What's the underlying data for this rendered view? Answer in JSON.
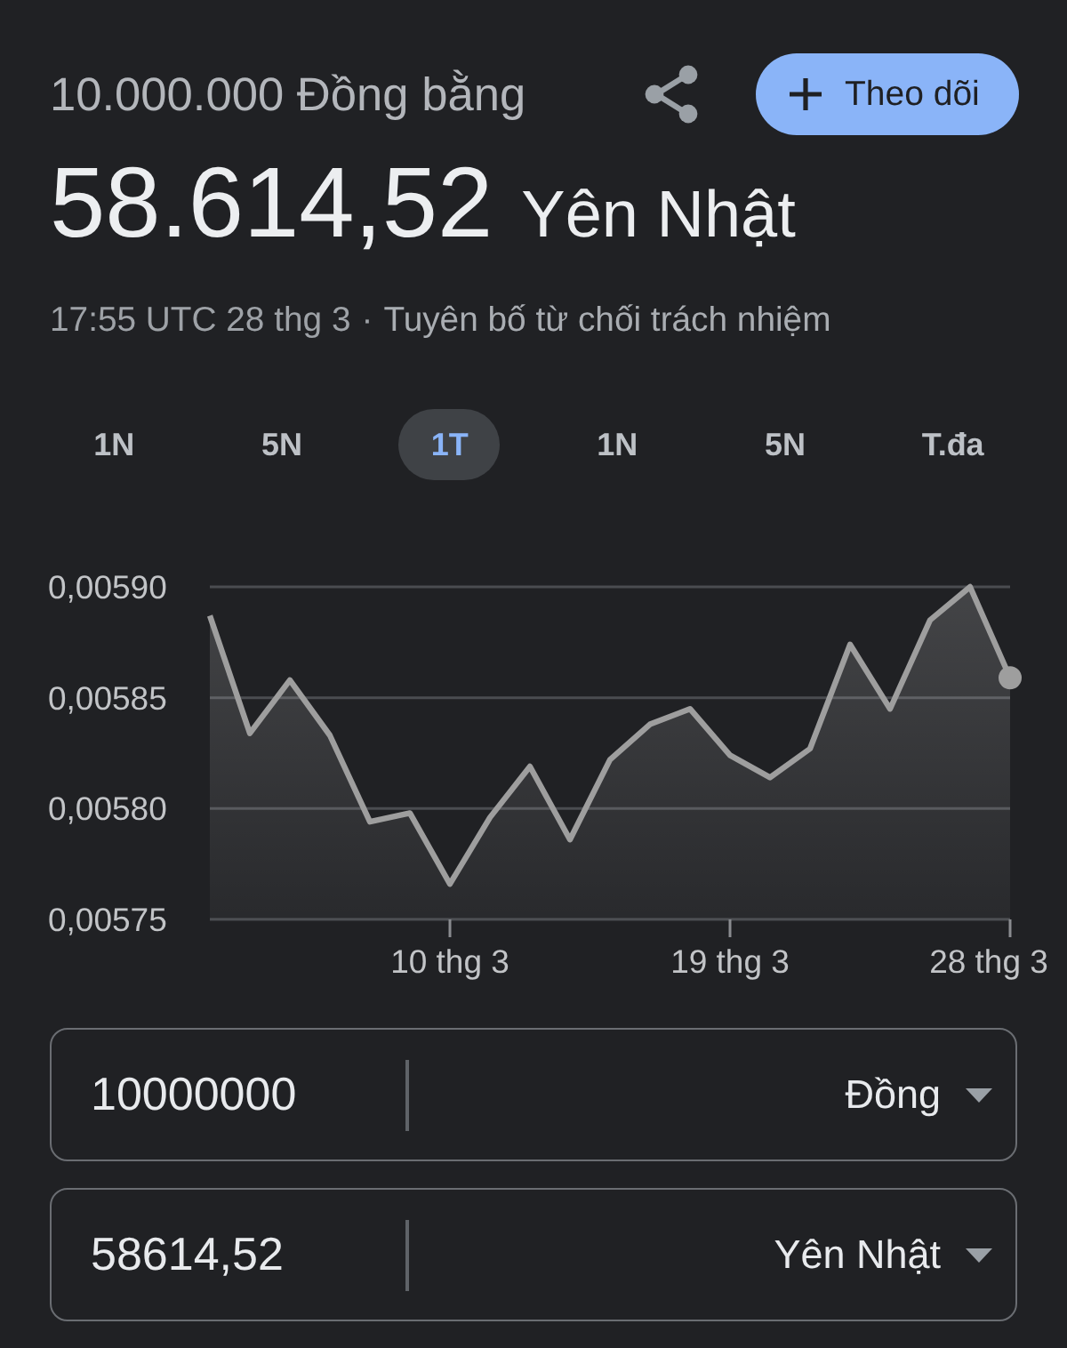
{
  "header": {
    "source_amount": "10.000.000 Đồng bằng",
    "follow_button": {
      "label": "Theo dõi"
    }
  },
  "result": {
    "value": "58.614,52",
    "currency": "Yên Nhật"
  },
  "updated": {
    "time": "17:55 UTC 28 thg 3",
    "separator": "·",
    "disclaimer": "Tuyên bố từ chối trách nhiệm"
  },
  "ranges": [
    {
      "label": "1N",
      "selected": false
    },
    {
      "label": "5N",
      "selected": false
    },
    {
      "label": "1T",
      "selected": true
    },
    {
      "label": "1N",
      "selected": false
    },
    {
      "label": "5N",
      "selected": false
    },
    {
      "label": "T.đa",
      "selected": false
    }
  ],
  "chart": {
    "chart_data": {
      "type": "area",
      "grid": true,
      "categories": [
        null,
        null,
        null,
        null,
        null,
        null,
        "10 thg 3",
        null,
        null,
        null,
        null,
        null,
        null,
        "19 thg 3",
        null,
        null,
        null,
        null,
        null,
        null,
        "28 thg 3"
      ],
      "series": [
        {
          "color": "#9e9e9e",
          "values": [
            0.005887,
            0.005834,
            0.005858,
            0.005833,
            0.005794,
            0.005798,
            0.005766,
            0.005796,
            0.005819,
            0.005786,
            0.005822,
            0.005838,
            0.005845,
            0.005824,
            0.005814,
            0.005827,
            0.005874,
            0.005845,
            0.005885,
            0.0059,
            0.005859
          ]
        }
      ],
      "ylim": [
        0.00575,
        0.0059
      ],
      "yticks": [
        {
          "value": 0.0059,
          "label": "0,00590"
        },
        {
          "value": 0.00585,
          "label": "0,00585"
        },
        {
          "value": 0.0058,
          "label": "0,00580"
        },
        {
          "value": 0.00575,
          "label": "0,00575"
        }
      ]
    }
  },
  "converter": [
    {
      "amount": "10000000",
      "currency": "Đồng"
    },
    {
      "amount": "58614,52",
      "currency": "Yên Nhật"
    }
  ]
}
